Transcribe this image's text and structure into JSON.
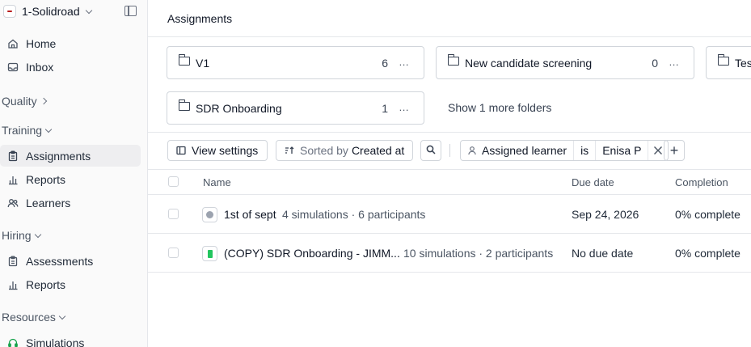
{
  "sidebar": {
    "workspace": "1-Solidroad",
    "items_top": [
      {
        "label": "Home",
        "icon": "home-icon"
      },
      {
        "label": "Inbox",
        "icon": "inbox-icon"
      }
    ],
    "sections": {
      "quality": "Quality",
      "training": "Training",
      "hiring": "Hiring",
      "resources": "Resources"
    },
    "training_items": [
      {
        "label": "Assignments",
        "icon": "clipboard-icon",
        "active": true
      },
      {
        "label": "Reports",
        "icon": "bar-chart-icon"
      },
      {
        "label": "Learners",
        "icon": "users-icon"
      }
    ],
    "hiring_items": [
      {
        "label": "Assessments",
        "icon": "clipboard-icon"
      },
      {
        "label": "Reports",
        "icon": "bar-chart-icon"
      }
    ],
    "resources_items": [
      {
        "label": "Simulations",
        "icon": "headset-icon"
      }
    ]
  },
  "main": {
    "title": "Assignments",
    "folders": [
      {
        "name": "V1",
        "count": "6",
        "more": "..."
      },
      {
        "name": "New candidate screening",
        "count": "0",
        "more": "..."
      },
      {
        "name": "Tes",
        "count": "",
        "more": ""
      },
      {
        "name": "SDR Onboarding",
        "count": "1",
        "more": "..."
      }
    ],
    "show_more": "Show 1 more folders",
    "toolbar": {
      "view_settings": "View settings",
      "sorted_by_prefix": "Sorted by",
      "sorted_by_value": "Created at",
      "filter_field": "Assigned learner",
      "filter_op": "is",
      "filter_value": "Enisa P",
      "add": "+"
    },
    "table": {
      "headers": {
        "name": "Name",
        "due": "Due date",
        "completion": "Completion"
      },
      "rows": [
        {
          "name": "1st of sept",
          "meta": "4 simulations · 6 participants",
          "due": "Sep 24, 2026",
          "completion": "0% complete",
          "icon": "gray-dot-icon"
        },
        {
          "name": "(COPY) SDR Onboarding - JIMM...",
          "meta": "10 simulations · 2 participants",
          "due": "No due date",
          "completion": "0% complete",
          "icon": "green-doc-icon"
        }
      ]
    }
  }
}
